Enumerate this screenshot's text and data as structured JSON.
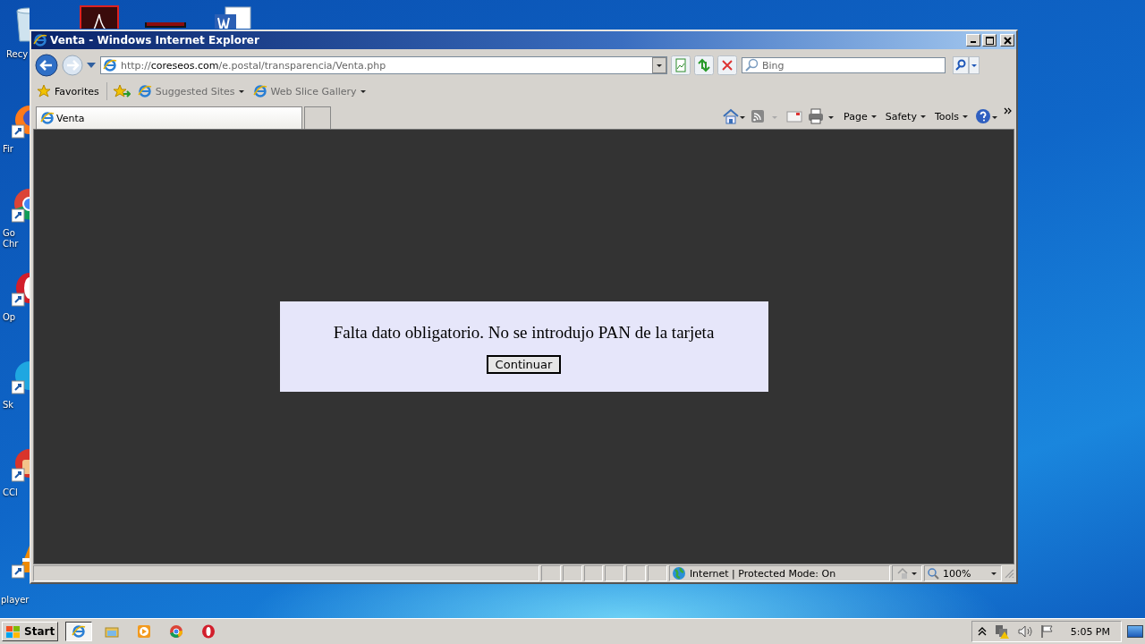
{
  "desktop": {
    "icons": [
      {
        "kind": "recycle",
        "label": "Recy"
      },
      {
        "kind": "firefox",
        "label": "Fir"
      },
      {
        "kind": "chrome",
        "label": "Go\nChr"
      },
      {
        "kind": "opera",
        "label": "Op"
      },
      {
        "kind": "skype",
        "label": "Sk"
      },
      {
        "kind": "ccleaner",
        "label": "CCl"
      },
      {
        "kind": "vlc",
        "label": "player"
      }
    ],
    "top_icons": [
      {
        "kind": "pdf"
      },
      {
        "kind": "dark"
      },
      {
        "kind": "word"
      }
    ]
  },
  "window": {
    "title": "Venta - Windows Internet Explorer",
    "address": {
      "scheme": "http://",
      "domain": "coreseos.com",
      "path": "/e.postal/transparencia/Venta.php"
    },
    "search": {
      "placeholder": "Bing"
    },
    "favorites": "Favorites",
    "links": [
      "Suggested Sites",
      "Web Slice Gallery"
    ],
    "tabs": [
      {
        "label": "Venta",
        "selected": true
      }
    ],
    "commands": [
      "Page",
      "Safety",
      "Tools"
    ],
    "content": {
      "message": "Falta dato obligatorio. No se introdujo PAN de la tarjeta",
      "button": "Continuar"
    },
    "status_bar": {
      "zone": "Internet | Protected Mode: On",
      "zoom": "100%"
    }
  },
  "taskbar": {
    "start": "Start",
    "apps": [
      {
        "kind": "ie",
        "selected": true
      },
      {
        "kind": "explorer",
        "selected": false
      },
      {
        "kind": "media",
        "selected": false
      },
      {
        "kind": "chrome",
        "selected": false
      },
      {
        "kind": "opera",
        "selected": false
      }
    ],
    "clock": "5:05 PM"
  }
}
